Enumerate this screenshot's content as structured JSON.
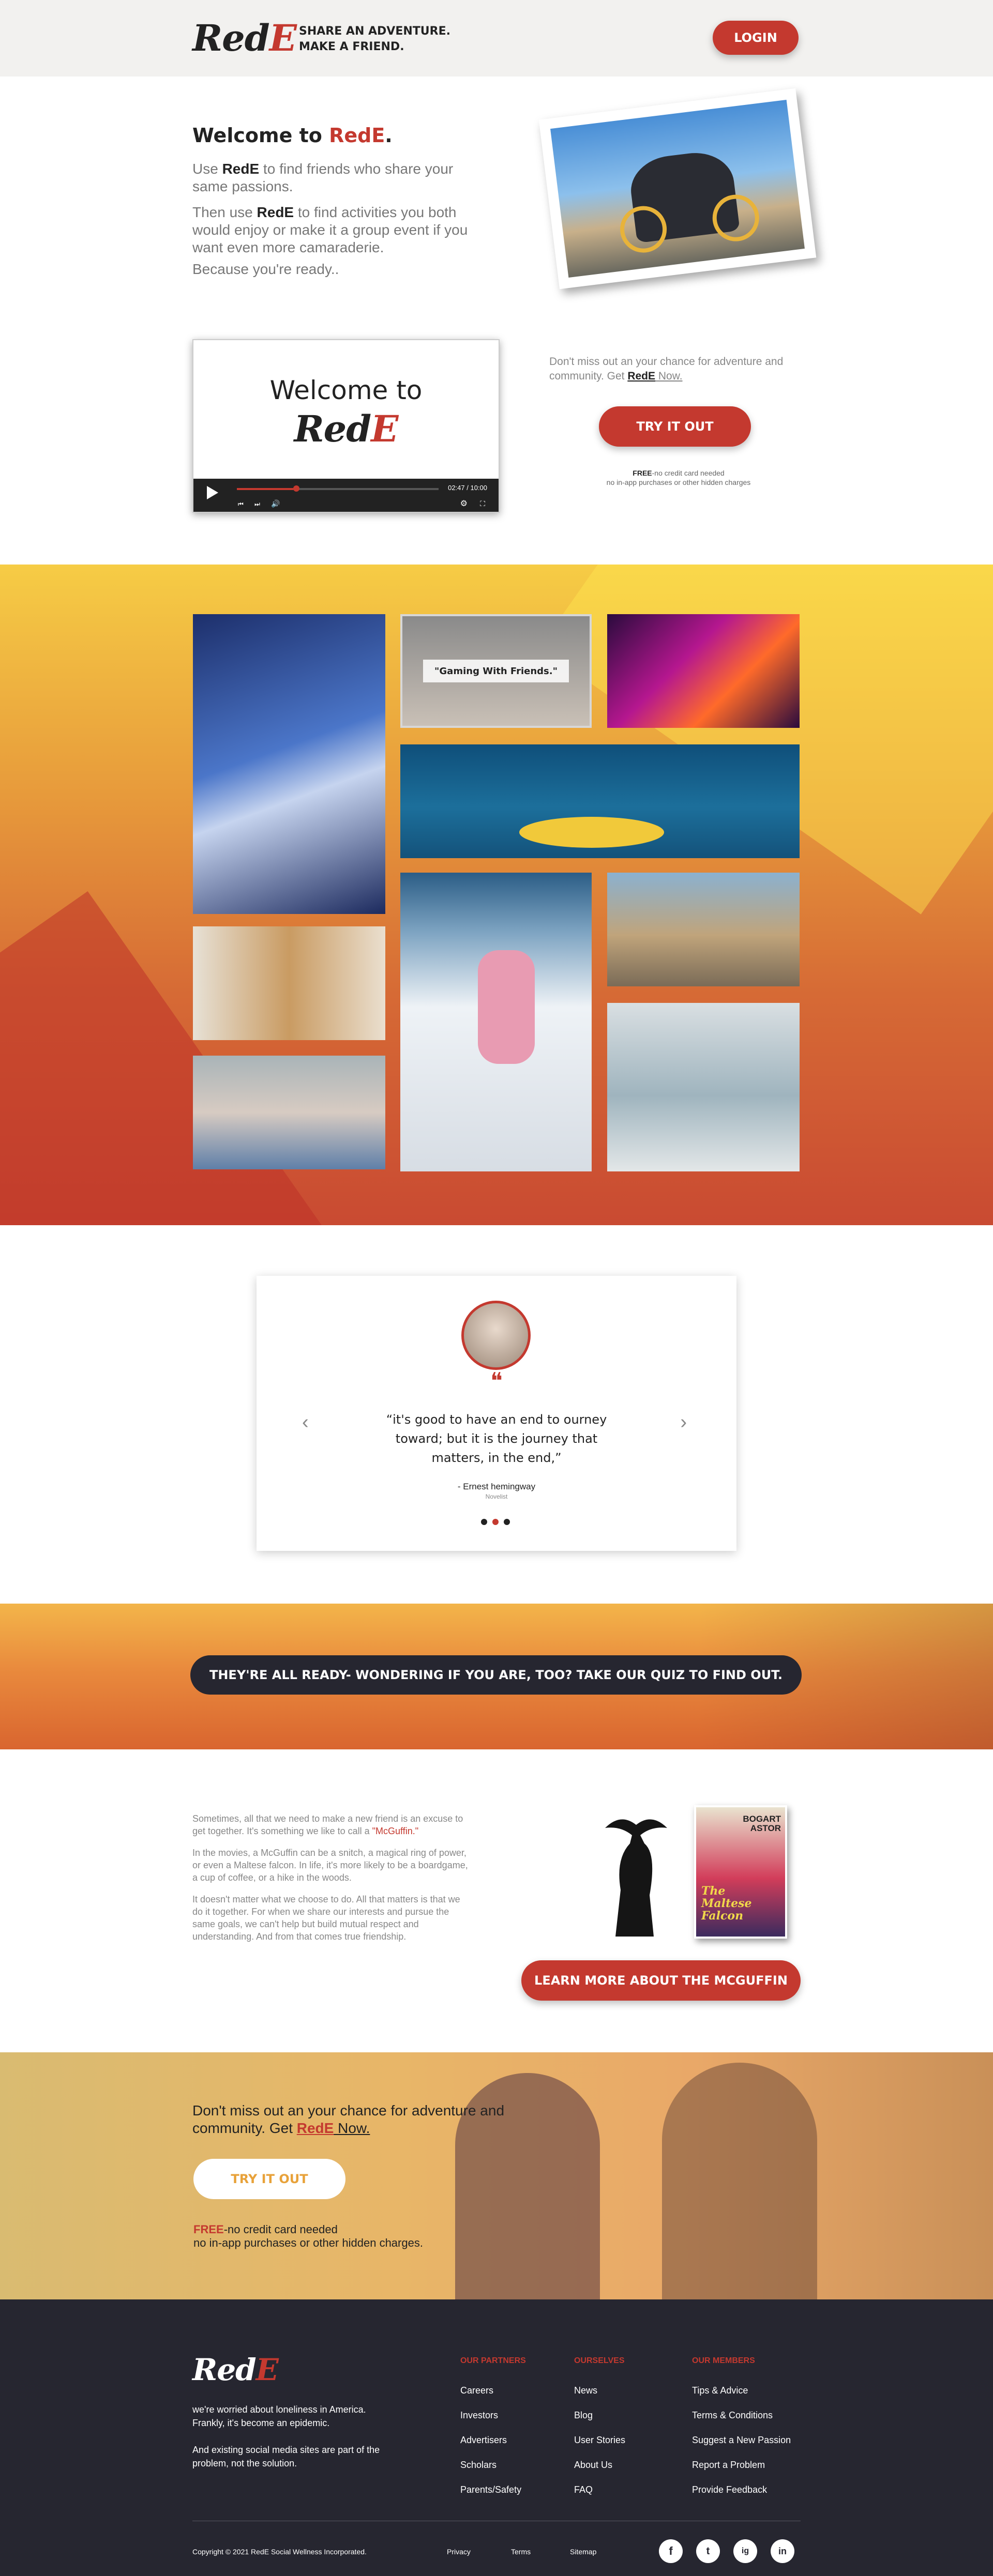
{
  "header": {
    "logo": "RedE",
    "logo_main": "Red",
    "logo_e": "E",
    "tagline_1": "SHARE AN ADVENTURE.",
    "tagline_2": "MAKE A FRIEND.",
    "login_label": "LOGIN"
  },
  "welcome": {
    "title_prefix": "Welcome to ",
    "title_brand": "RedE",
    "title_suffix": ".",
    "p1_a": "Use ",
    "p1_brand": "RedE",
    "p1_b": " to find friends who share your same passions.",
    "p2_a": "Then use ",
    "p2_brand": "RedE",
    "p2_b": " to find activities you both would enjoy or make it a group event if you want even more camaraderie.",
    "p3": "Because you're ready.."
  },
  "video": {
    "title": "Welcome to",
    "brand": "RedE",
    "time": "02:47 / 10:00"
  },
  "cta1": {
    "text_a": "Don't miss out an your chance for adventure and community. Get ",
    "text_brand": "RedE",
    "text_b": " Now.",
    "button": "TRY IT OUT",
    "note_free": "FREE",
    "note_1": "-no credit card needed",
    "note_2": "no in-app purchases or other hidden charges"
  },
  "gallery": {
    "gaming_caption": "\"Gaming With Friends.\""
  },
  "testimonial": {
    "quote": "“it's good to have an end to ourney toward; but it is the journey that matters, in the end,”",
    "author": "- Ernest hemingway",
    "role": "Novelist",
    "prev": "‹",
    "next": "›",
    "quote_mark": "❝"
  },
  "quiz_banner": {
    "text": "THEY'RE ALL READY- WONDERING IF YOU ARE, TOO? TAKE OUR QUIZ TO FIND OUT."
  },
  "mcguffin": {
    "p1": "Sometimes, all that we need to make a new friend is an excuse to get together. It's something we like to call a ",
    "p1_link": "\"McGuffin.\"",
    "p2": "In the movies, a McGuffin can be a snitch, a magical ring of power, or even a Maltese falcon. In life, it's more likely to be a boardgame, a cup of coffee, or a hike in the woods.",
    "p3": "It doesn't matter what we choose to do. All that matters is that we do it together. For when we share our interests and pursue the same goals, we can't help but build mutual respect and understanding. And from that comes true friendship.",
    "button": "LEARN MORE ABOUT THE MCGUFFIN",
    "poster_top_1": "BOGART",
    "poster_top_2": "ASTOR",
    "poster_title_1": "The",
    "poster_title_2": "Maltese",
    "poster_title_3": "Falcon"
  },
  "cta2": {
    "text_a": "Don't miss out an your chance for adventure and community. Get ",
    "text_brand": "RedE",
    "text_b": " Now.",
    "button": "TRY IT OUT",
    "note_free": "FREE",
    "note_1": "-no credit card needed",
    "note_2": "no in-app purchases or other hidden charges."
  },
  "footer": {
    "about_1": "we're worried about loneliness in America. Frankly, it's become an epidemic.",
    "about_2": "And existing social media sites are part of the problem, not the solution.",
    "col1_title": "OUR PARTNERS",
    "col1": [
      "Careers",
      "Investors",
      "Advertisers",
      "Scholars",
      "Parents/Safety"
    ],
    "col2_title": "OURSELVES",
    "col2": [
      "News",
      "Blog",
      "User Stories",
      "About Us",
      "FAQ"
    ],
    "col3_title": "OUR MEMBERS",
    "col3": [
      "Tips & Advice",
      "Terms & Conditions",
      "Suggest a New Passion",
      "Report a Problem",
      "Provide Feedback"
    ],
    "copyright": "Copyright © 2021 RedE Social Wellness Incorporated.",
    "links": [
      "Privacy",
      "Terms",
      "Sitemap"
    ],
    "social": [
      "f",
      "t",
      "ig",
      "in"
    ]
  },
  "colors": {
    "accent": "#c4392f",
    "footer_bg": "#262630",
    "yellow": "#fcd84e",
    "orange": "#d96a36"
  }
}
